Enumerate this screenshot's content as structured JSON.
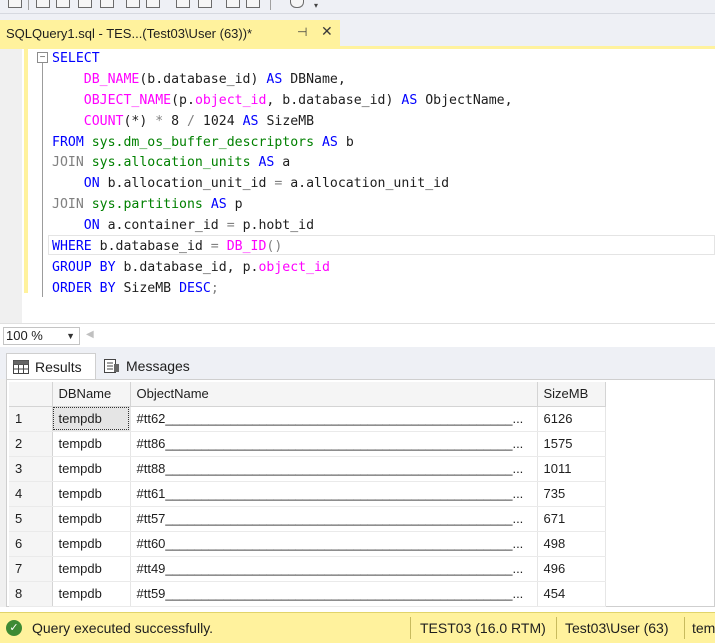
{
  "document_tab": {
    "title": "SQLQuery1.sql - TES...(Test03\\User (63))*",
    "pin_icon": "pin-icon",
    "close_icon": "close-icon"
  },
  "editor": {
    "lines": [
      [
        {
          "t": "SELECT",
          "c": "kw"
        }
      ],
      [
        {
          "t": "    ",
          "c": "tx"
        },
        {
          "t": "DB_NAME",
          "c": "fn"
        },
        {
          "t": "(b.database_id) ",
          "c": "tx"
        },
        {
          "t": "AS",
          "c": "kw"
        },
        {
          "t": " DBName,",
          "c": "tx"
        }
      ],
      [
        {
          "t": "    ",
          "c": "tx"
        },
        {
          "t": "OBJECT_NAME",
          "c": "fn"
        },
        {
          "t": "(p.",
          "c": "tx"
        },
        {
          "t": "object_id",
          "c": "fn"
        },
        {
          "t": ", b.database_id) ",
          "c": "tx"
        },
        {
          "t": "AS",
          "c": "kw"
        },
        {
          "t": " ObjectName,",
          "c": "tx"
        }
      ],
      [
        {
          "t": "    ",
          "c": "tx"
        },
        {
          "t": "COUNT",
          "c": "fn"
        },
        {
          "t": "(*) ",
          "c": "tx"
        },
        {
          "t": "*",
          "c": "gr"
        },
        {
          "t": " 8 ",
          "c": "tx"
        },
        {
          "t": "/",
          "c": "gr"
        },
        {
          "t": " 1024 ",
          "c": "tx"
        },
        {
          "t": "AS",
          "c": "kw"
        },
        {
          "t": " SizeMB",
          "c": "tx"
        }
      ],
      [
        {
          "t": "FROM",
          "c": "kw"
        },
        {
          "t": " ",
          "c": "tx"
        },
        {
          "t": "sys.dm_os_buffer_descriptors",
          "c": "obj"
        },
        {
          "t": " ",
          "c": "tx"
        },
        {
          "t": "AS",
          "c": "kw"
        },
        {
          "t": " b",
          "c": "tx"
        }
      ],
      [
        {
          "t": "JOIN",
          "c": "gr"
        },
        {
          "t": " ",
          "c": "tx"
        },
        {
          "t": "sys.allocation_units",
          "c": "obj"
        },
        {
          "t": " ",
          "c": "tx"
        },
        {
          "t": "AS",
          "c": "kw"
        },
        {
          "t": " a",
          "c": "tx"
        }
      ],
      [
        {
          "t": "    ",
          "c": "tx"
        },
        {
          "t": "ON",
          "c": "kw"
        },
        {
          "t": " b.allocation_unit_id ",
          "c": "tx"
        },
        {
          "t": "=",
          "c": "gr"
        },
        {
          "t": " a.allocation_unit_id",
          "c": "tx"
        }
      ],
      [
        {
          "t": "JOIN",
          "c": "gr"
        },
        {
          "t": " ",
          "c": "tx"
        },
        {
          "t": "sys.partitions",
          "c": "obj"
        },
        {
          "t": " ",
          "c": "tx"
        },
        {
          "t": "AS",
          "c": "kw"
        },
        {
          "t": " p",
          "c": "tx"
        }
      ],
      [
        {
          "t": "    ",
          "c": "tx"
        },
        {
          "t": "ON",
          "c": "kw"
        },
        {
          "t": " a.container_id ",
          "c": "tx"
        },
        {
          "t": "=",
          "c": "gr"
        },
        {
          "t": " p.hobt_id",
          "c": "tx"
        }
      ],
      [
        {
          "t": "WHERE",
          "c": "kw"
        },
        {
          "t": " b.database_id ",
          "c": "tx"
        },
        {
          "t": "=",
          "c": "gr"
        },
        {
          "t": " ",
          "c": "tx"
        },
        {
          "t": "DB_ID",
          "c": "fn"
        },
        {
          "t": "()",
          "c": "gr"
        }
      ],
      [
        {
          "t": "GROUP BY",
          "c": "kw"
        },
        {
          "t": " b.database_id, p.",
          "c": "tx"
        },
        {
          "t": "object_id",
          "c": "fn"
        }
      ],
      [
        {
          "t": "ORDER BY",
          "c": "kw"
        },
        {
          "t": " SizeMB ",
          "c": "tx"
        },
        {
          "t": "DESC",
          "c": "kw"
        },
        {
          "t": ";",
          "c": "gr"
        }
      ]
    ]
  },
  "zoom": {
    "value": "100 %"
  },
  "results": {
    "tabs": [
      {
        "label": "Results",
        "icon": "grid-icon"
      },
      {
        "label": "Messages",
        "icon": "messages-icon"
      }
    ],
    "columns": [
      "DBName",
      "ObjectName",
      "SizeMB"
    ],
    "rows": [
      {
        "n": "1",
        "db": "tempdb",
        "obj": "#tt62________________________________________________...",
        "size": "6126"
      },
      {
        "n": "2",
        "db": "tempdb",
        "obj": "#tt86________________________________________________...",
        "size": "1575"
      },
      {
        "n": "3",
        "db": "tempdb",
        "obj": "#tt88________________________________________________...",
        "size": "1011"
      },
      {
        "n": "4",
        "db": "tempdb",
        "obj": "#tt61________________________________________________...",
        "size": "735"
      },
      {
        "n": "5",
        "db": "tempdb",
        "obj": "#tt57________________________________________________...",
        "size": "671"
      },
      {
        "n": "6",
        "db": "tempdb",
        "obj": "#tt60________________________________________________...",
        "size": "498"
      },
      {
        "n": "7",
        "db": "tempdb",
        "obj": "#tt49________________________________________________...",
        "size": "496"
      },
      {
        "n": "8",
        "db": "tempdb",
        "obj": "#tt59________________________________________________...",
        "size": "454"
      }
    ]
  },
  "statusbar": {
    "message": "Query executed successfully.",
    "server": "TEST03 (16.0 RTM)",
    "user": "Test03\\User (63)",
    "database": "tem"
  },
  "colors": {
    "accent": "#fff29d",
    "keyword": "#0000ff",
    "function": "#ff00ff",
    "system_object": "#008000",
    "operator": "#808080",
    "success": "#3d8a34"
  }
}
